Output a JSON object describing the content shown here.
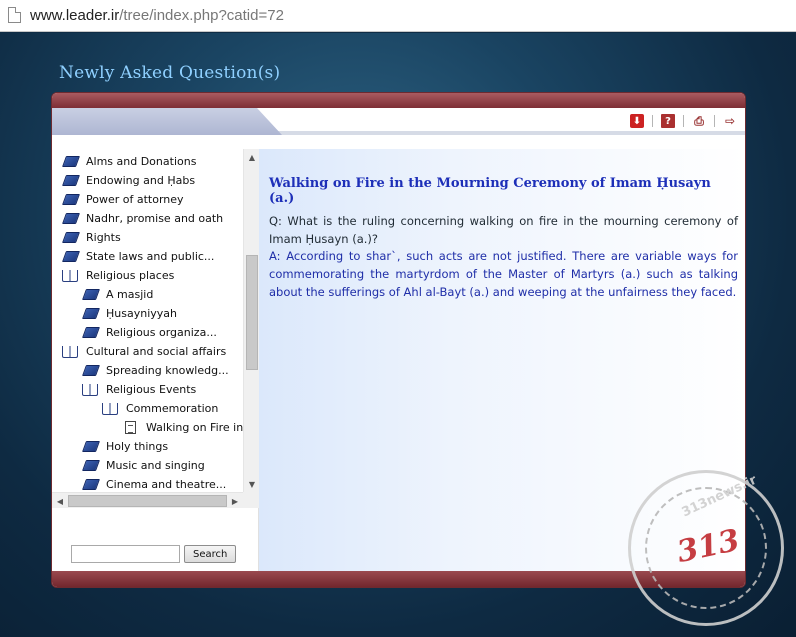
{
  "browser": {
    "url_domain": "www.leader.ir",
    "url_path": "/tree/index.php?catid=72"
  },
  "page": {
    "title": "Newly Asked Question(s)"
  },
  "toolbar": {
    "icons": [
      "download-icon",
      "help-icon",
      "print-icon",
      "exit-icon"
    ],
    "help_glyph": "?"
  },
  "tree": {
    "items": [
      {
        "label": "Alms and Donations",
        "icon": "book-closed",
        "level": 0
      },
      {
        "label": "Endowing and Ḥabs",
        "icon": "book-closed",
        "level": 0
      },
      {
        "label": "Power of attorney",
        "icon": "book-closed",
        "level": 0
      },
      {
        "label": "Nadhr, promise and oath",
        "icon": "book-closed",
        "level": 0
      },
      {
        "label": "Rights",
        "icon": "book-closed",
        "level": 0
      },
      {
        "label": "State laws and public...",
        "icon": "book-closed",
        "level": 0
      },
      {
        "label": "Religious places",
        "icon": "book-open",
        "level": 0
      },
      {
        "label": "A masjid",
        "icon": "book-closed",
        "level": 1
      },
      {
        "label": "Ḥusayniyyah",
        "icon": "book-closed",
        "level": 1
      },
      {
        "label": "Religious organiza...",
        "icon": "book-closed",
        "level": 1
      },
      {
        "label": "Cultural and social affairs",
        "icon": "book-open",
        "level": 0
      },
      {
        "label": "Spreading knowledg...",
        "icon": "book-closed",
        "level": 1
      },
      {
        "label": "Religious Events",
        "icon": "book-open",
        "level": 1
      },
      {
        "label": "Commemoration",
        "icon": "book-open",
        "level": 2
      },
      {
        "label": "Walking on Fire in...",
        "icon": "doc",
        "level": 3
      },
      {
        "label": "Holy things",
        "icon": "book-closed",
        "level": 1
      },
      {
        "label": "Music and singing",
        "icon": "book-closed",
        "level": 1
      },
      {
        "label": "Cinema and theatre...",
        "icon": "book-closed",
        "level": 1
      }
    ]
  },
  "search": {
    "value": "",
    "button_label": "Search"
  },
  "article": {
    "title": "Walking on Fire in the Mourning Ceremony of Imam Ḥusayn (a.)",
    "question": "Q: What is the ruling concerning walking on fire in the mourning ceremony of Imam Ḥusayn (a.)?",
    "answer": "A: According to shar`, such acts are not justified. There are variable ways for commemorating the martyrdom of the Master of Martyrs (a.) such as talking about the sufferings of Ahl al-Bayt (a.) and weeping at the unfairness they faced."
  },
  "watermark": {
    "number": "313",
    "ring_text": "313news.ir"
  },
  "colors": {
    "accent_title": "#8fd0ff",
    "article_title": "#1d2fb8",
    "answer_text": "#1f2ea8",
    "frame_bar": "#7d2d35"
  }
}
